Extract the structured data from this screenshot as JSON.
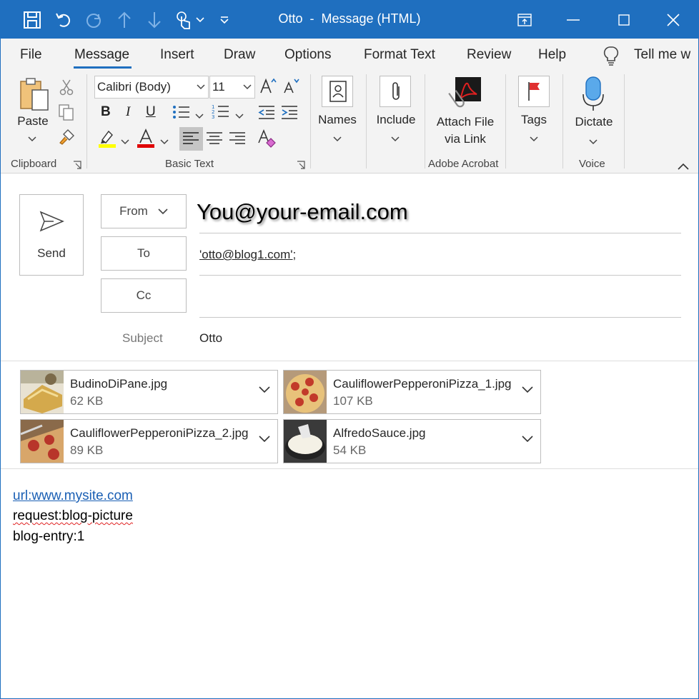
{
  "window": {
    "title_left": "Otto",
    "title_right": "Message (HTML)",
    "title_sep": "-"
  },
  "tabs": [
    "File",
    "Message",
    "Insert",
    "Draw",
    "Options",
    "Format Text",
    "Review",
    "Help",
    "Tell me w"
  ],
  "ribbon": {
    "clipboard": {
      "paste_label": "Paste",
      "group_label": "Clipboard"
    },
    "basic_text": {
      "font_name": "Calibri (Body)",
      "font_size": "11",
      "bold": "B",
      "italic": "I",
      "underline": "U",
      "group_label": "Basic Text"
    },
    "names_label": "Names",
    "include_label": "Include",
    "attach_label_line1": "Attach File",
    "attach_label_line2": "via Link",
    "adobe_group_label": "Adobe Acrobat",
    "tags_label": "Tags",
    "dictate_label": "Dictate",
    "voice_group_label": "Voice"
  },
  "header": {
    "send_label": "Send",
    "from_label": "From",
    "from_value": "You@your-email.com",
    "to_label": "To",
    "to_value": "'otto@blog1.com'",
    "to_suffix": ";",
    "cc_label": "Cc",
    "cc_value": "",
    "subject_label": "Subject",
    "subject_value": "Otto"
  },
  "attachments": [
    {
      "name": "BudinoDiPane.jpg",
      "size": "62 KB"
    },
    {
      "name": "CauliflowerPepperoniPizza_1.jpg",
      "size": "107 KB"
    },
    {
      "name": "CauliflowerPepperoniPizza_2.jpg",
      "size": "89 KB"
    },
    {
      "name": "AlfredoSauce.jpg",
      "size": "54 KB"
    }
  ],
  "body": {
    "line1": "url:www.mysite.com",
    "line2": "request:blog-picture",
    "line3": "blog-entry:1"
  },
  "colors": {
    "accent": "#1f6fbf",
    "ribbon_bg": "#f3f3f3",
    "link": "#1a5fb4",
    "highlight_yellow": "#ffff00",
    "font_red": "#e00000"
  }
}
